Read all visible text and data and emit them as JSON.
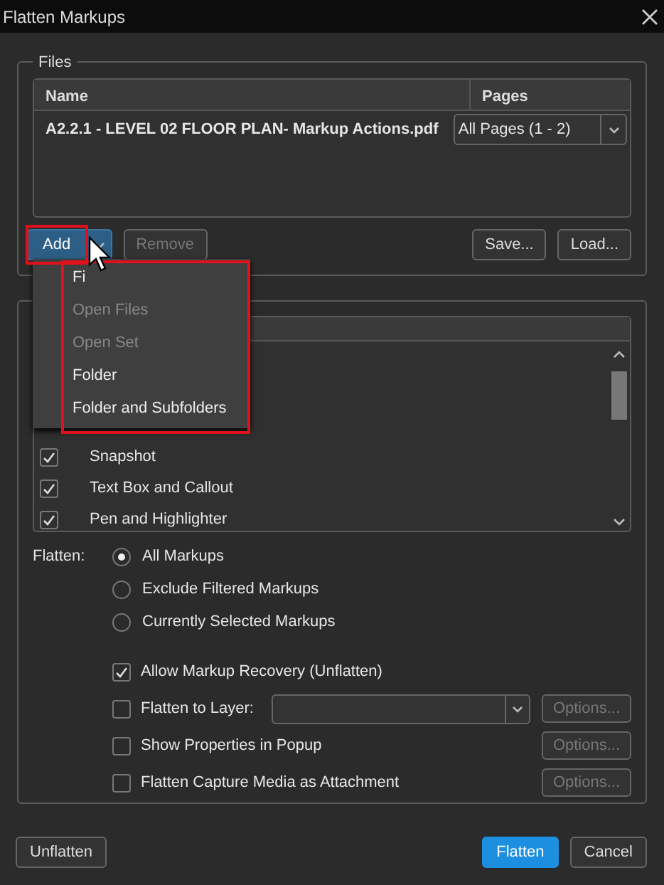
{
  "window": {
    "title": "Flatten Markups"
  },
  "files": {
    "legend": "Files",
    "columns": [
      "Name",
      "Pages"
    ],
    "rows": [
      {
        "name": "A2.2.1 - LEVEL 02 FLOOR PLAN- Markup Actions.pdf",
        "pages": "All Pages (1 - 2)"
      }
    ],
    "buttons": [
      {
        "label": "Add",
        "kind": "split",
        "disabled": false
      },
      {
        "label": "Remove",
        "kind": "plain",
        "disabled": true
      },
      {
        "label": "Save...",
        "kind": "plain",
        "disabled": false
      },
      {
        "label": "Load...",
        "kind": "plain",
        "disabled": false
      }
    ]
  },
  "add_menu": [
    {
      "label": "Fi",
      "disabled": false
    },
    {
      "label": "Open Files",
      "disabled": true
    },
    {
      "label": "Open Set",
      "disabled": true
    },
    {
      "label": "Folder",
      "disabled": false
    },
    {
      "label": "Folder and Subfolders",
      "disabled": false
    }
  ],
  "markup_types": [
    {
      "label": "Snapshot",
      "checked": true
    },
    {
      "label": "Text Box and Callout",
      "checked": true
    },
    {
      "label": "Pen and Highlighter",
      "checked": true
    }
  ],
  "flatten": {
    "label": "Flatten:",
    "choices": [
      {
        "label": "All Markups",
        "selected": true
      },
      {
        "label": "Exclude Filtered Markups",
        "selected": false
      },
      {
        "label": "Currently Selected Markups",
        "selected": false
      }
    ]
  },
  "options": [
    {
      "label": "Allow Markup Recovery (Unflatten)",
      "checked": true,
      "kind": "plain"
    },
    {
      "label": "Flatten to Layer:",
      "checked": false,
      "kind": "layer",
      "button": "Options..."
    },
    {
      "label": "Show Properties in Popup",
      "checked": false,
      "kind": "button",
      "button": "Options..."
    },
    {
      "label": "Flatten Capture Media as Attachment",
      "checked": false,
      "kind": "button",
      "button": "Options..."
    }
  ],
  "footer": [
    {
      "label": "Unflatten",
      "kind": "plain"
    },
    {
      "label": "Flatten",
      "kind": "primary"
    },
    {
      "label": "Cancel",
      "kind": "plain"
    }
  ]
}
